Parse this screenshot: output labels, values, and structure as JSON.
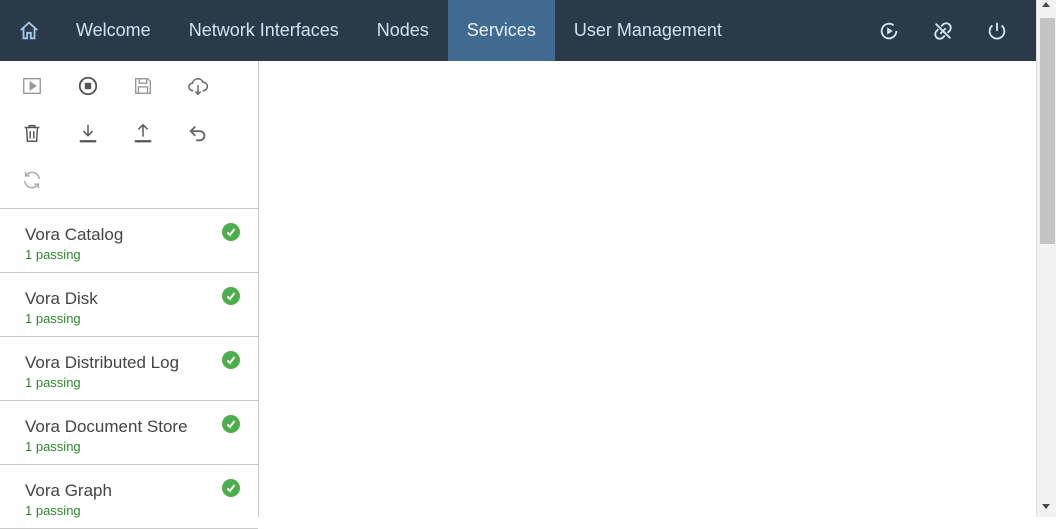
{
  "nav": {
    "tabs": [
      {
        "label": "Welcome",
        "active": false
      },
      {
        "label": "Network Interfaces",
        "active": false
      },
      {
        "label": "Nodes",
        "active": false
      },
      {
        "label": "Services",
        "active": true
      },
      {
        "label": "User Management",
        "active": false
      }
    ],
    "icons": [
      "home-icon",
      "play-circle-icon",
      "disconnect-icon",
      "power-icon"
    ]
  },
  "toolbar": {
    "icons": [
      "play-icon",
      "stop-icon",
      "save-icon",
      "cloud-download-icon",
      "trash-icon",
      "download-icon",
      "upload-icon",
      "undo-icon",
      "refresh-icon"
    ]
  },
  "services": [
    {
      "name": "Vora Catalog",
      "status": "1 passing"
    },
    {
      "name": "Vora Disk",
      "status": "1 passing"
    },
    {
      "name": "Vora Distributed Log",
      "status": "1 passing"
    },
    {
      "name": "Vora Document Store",
      "status": "1 passing"
    },
    {
      "name": "Vora Graph",
      "status": "1 passing"
    }
  ],
  "colors": {
    "topbar": "#2b3a49",
    "active_tab": "#416a91",
    "passing": "#4cae4c"
  }
}
